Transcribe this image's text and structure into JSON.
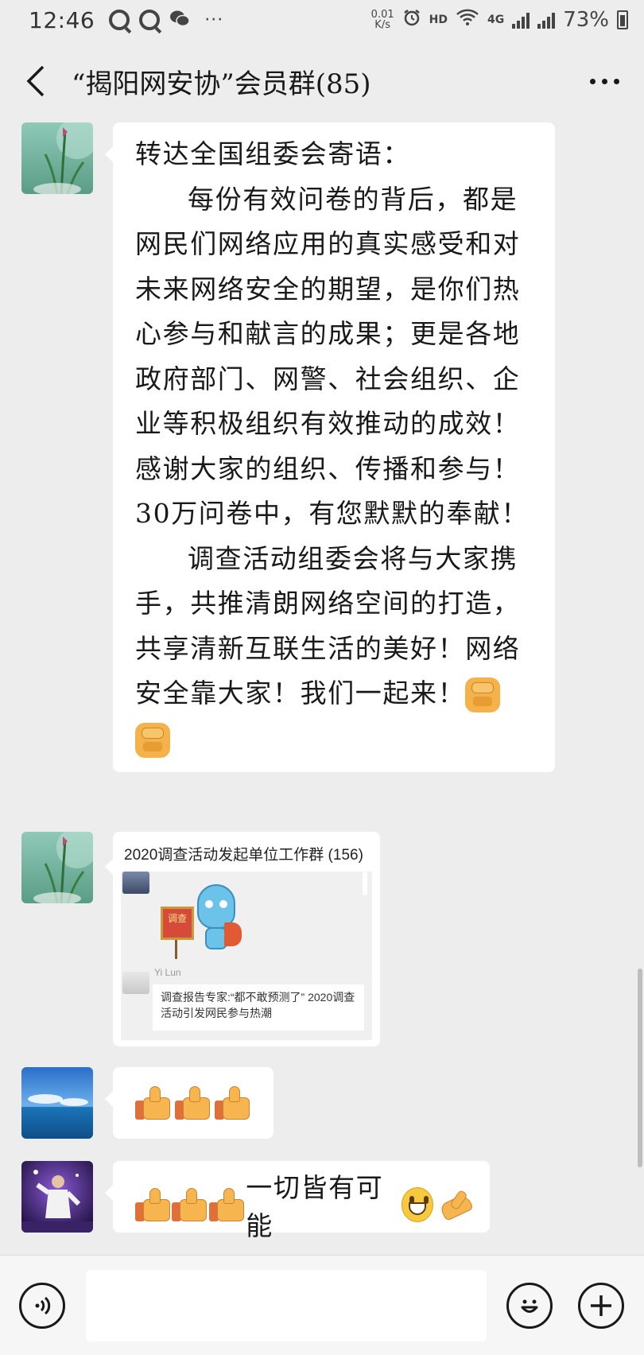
{
  "status_bar": {
    "time": "12:46",
    "app_icons": [
      "q-icon",
      "q-icon",
      "wechat-icon"
    ],
    "more_notifications": "···",
    "net_speed_value": "0.01",
    "net_speed_unit": "K/s",
    "hd_label": "HD",
    "network_label": "4G",
    "battery_percent": "73%"
  },
  "header": {
    "title": "“揭阳网安协”会员群(85)"
  },
  "messages": [
    {
      "type": "text",
      "paragraphs": [
        "转达全国组委会寄语：",
        "每份有效问卷的背后，都是网民们网络应用的真实感受和对未来网络安全的期望，是你们热心参与和献言的成果；更是各地政府部门、网警、社会组织、企业等积极组织有效推动的成效！感谢大家的组织、传播和参与！30万问卷中，有您默默的奉献！",
        "调查活动组委会将与大家携手，共推清朗网络空间的打造，共享清新互联生活的美好！网络安全靠大家！我们一起来！"
      ],
      "trailing_emojis": [
        "fist-emoji",
        "fist-emoji"
      ]
    },
    {
      "type": "chat_record",
      "title": "2020调查活动发起单位工作群 (156)",
      "sender_name": "Yi Lun",
      "sign_text": "调查",
      "quote": "调查报告专家:“都不敢预测了” 2020调查活动引发网民参与热潮"
    },
    {
      "type": "emoji_only",
      "emojis": [
        "thumbs-up-emoji",
        "thumbs-up-emoji",
        "thumbs-up-emoji"
      ]
    },
    {
      "type": "mixed",
      "text": "一切皆有可能",
      "leading_emojis": [
        "thumbs-up-emoji",
        "thumbs-up-emoji",
        "thumbs-up-emoji"
      ],
      "trailing_emojis": [
        "grin-emoji",
        "ok-hand-emoji"
      ]
    }
  ],
  "input_bar": {
    "input_value": "",
    "buttons": [
      "voice-icon",
      "emoji-icon",
      "plus-icon"
    ]
  }
}
